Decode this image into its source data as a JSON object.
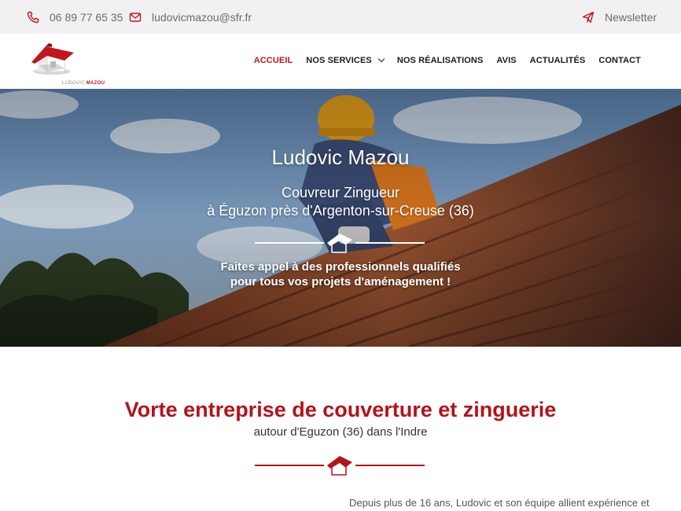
{
  "topbar": {
    "phone": "06 89 77 65 35",
    "email": "ludovicmazou@sfr.fr",
    "newsletter": "Newsletter",
    "icons": {
      "phone": "phone-icon",
      "email": "mail-icon",
      "newsletter": "paper-plane-icon"
    },
    "icon_color": "#c3151d"
  },
  "logo": {
    "first": "LUDOVIC",
    "last": "MAZOU"
  },
  "nav": {
    "items": [
      {
        "label": "ACCUEIL",
        "active": true
      },
      {
        "label": "NOS SERVICES",
        "dropdown": true
      },
      {
        "label": "NOS RÉALISATIONS"
      },
      {
        "label": "AVIS"
      },
      {
        "label": "ACTUALITÉS"
      },
      {
        "label": "CONTACT"
      }
    ]
  },
  "hero": {
    "title": "Ludovic Mazou",
    "subtitle_line1": "Couvreur Zingueur",
    "subtitle_line2": "à Éguzon près d'Argenton-sur-Creuse (36)",
    "cta_line1": "Faites appel à des professionnels qualifiés",
    "cta_line2": "pour tous vos projets d'aménagement !"
  },
  "intro": {
    "title": "Vorte entreprise de couverture et zinguerie",
    "subtitle": "autour d'Eguzon (36) dans l'Indre",
    "paragraph_start": "Depuis plus de 16 ans, Ludovic et son équipe allient expérience et"
  },
  "colors": {
    "brand_red": "#b5121b",
    "topbar_bg": "#f1f1f4",
    "text_dark": "#1b1b1b"
  }
}
